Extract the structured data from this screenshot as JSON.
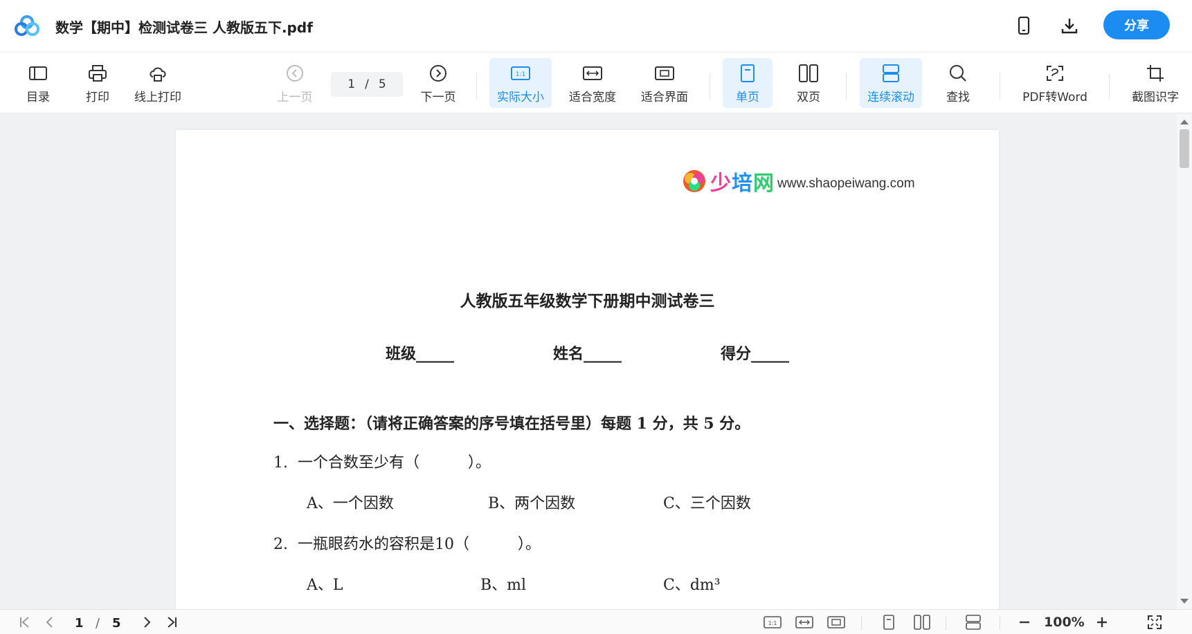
{
  "app": {
    "doc_title": "数学【期中】检测试卷三 人教版五下.pdf",
    "share_label": "分享",
    "mobile_icon": "phone-icon",
    "download_icon": "download-icon",
    "accent_color": "#1b8cf2"
  },
  "toolbar": {
    "toc": "目录",
    "print": "打印",
    "online_print": "线上打印",
    "prev_page": "上一页",
    "page_current": "1",
    "page_sep": "/",
    "page_total": "5",
    "next_page": "下一页",
    "actual_size": "实际大小",
    "fit_width": "适合宽度",
    "fit_window": "适合界面",
    "single_page": "单页",
    "double_page": "双页",
    "continuous_scroll": "连续滚动",
    "find": "查找",
    "pdf_to_word": "PDF转Word",
    "screenshot_ocr": "截图识字",
    "actual_size_icon_text": "1:1"
  },
  "document": {
    "watermark_brand": "少培网",
    "watermark_url": "www.shaopeiwang.com",
    "title": "人教版五年级数学下册期中测试卷三",
    "info_line": "班级_____   姓名_____   得分_____",
    "section1": "一、选择题：（请将正确答案的序号填在括号里）每题 1 分，共 5 分。",
    "q1": "1.  一个合数至少有（          ）。",
    "q1_a": "A、一个因数",
    "q1_b": "B、两个因数",
    "q1_c": "C、三个因数",
    "q2": "2.  一瓶眼药水的容积是10（          ）。",
    "q2_a": "A、L",
    "q2_b": "B、ml",
    "q2_c": "C、dm³"
  },
  "statusbar": {
    "page_current": "1",
    "page_sep": "/",
    "page_total": "5",
    "zoom": "100%",
    "actual_size_icon_text": "1:1"
  }
}
